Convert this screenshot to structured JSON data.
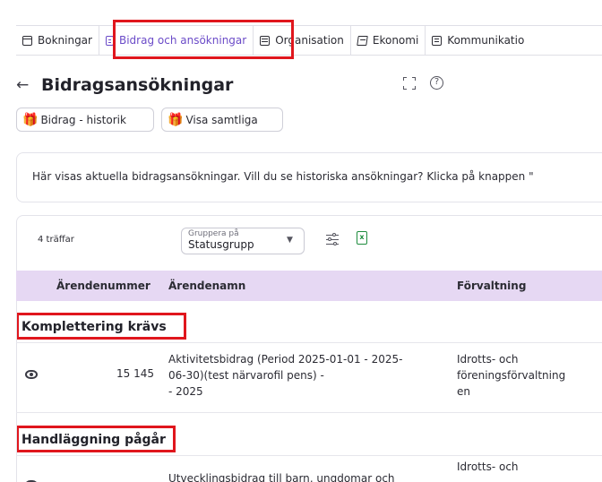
{
  "tabs": [
    {
      "label": "Bokningar",
      "icon": "calendar-icon"
    },
    {
      "label": "Bidrag och ansökningar",
      "icon": "clipboard-icon",
      "active": true
    },
    {
      "label": "Organisation",
      "icon": "building-icon"
    },
    {
      "label": "Ekonomi",
      "icon": "receipt-icon"
    },
    {
      "label": "Kommunikatio",
      "icon": "message-icon"
    }
  ],
  "colors": {
    "accent": "#6b4bc8",
    "highlight": "#e0161d",
    "table_header": "#e6d8f3"
  },
  "page": {
    "back_icon": "←",
    "title": "Bidragsansökningar",
    "help_icon": "?"
  },
  "buttons": {
    "history": "Bidrag - historik",
    "show_all": "Visa samtliga"
  },
  "info": {
    "text": "Här visas aktuella bidragsansökningar. Vill du se historiska ansökningar? Klicka på knappen \""
  },
  "toolbar": {
    "hits": "4 träffar",
    "group_label": "Gruppera på",
    "group_value": "Statusgrupp"
  },
  "table": {
    "headers": {
      "number": "Ärendenummer",
      "name": "Ärendenamn",
      "admin": "Förvaltning"
    },
    "groups": [
      {
        "title": "Komplettering krävs",
        "rows": [
          {
            "number": "15 145",
            "name_lines": [
              "Aktivitetsbidrag (Period 2025-01-01 - 2025-",
              "06-30)(test närvarofil pens) -",
              "- 2025"
            ],
            "admin_lines": [
              "Idrotts- och",
              "föreningsförvaltning",
              "en"
            ]
          }
        ]
      },
      {
        "title": "Handläggning pågår",
        "rows": [
          {
            "number": "",
            "name_lines": [
              "Utvecklingsbidrag till barn, ungdomar och"
            ],
            "admin_lines": [
              "Idrotts- och"
            ]
          }
        ]
      }
    ]
  }
}
